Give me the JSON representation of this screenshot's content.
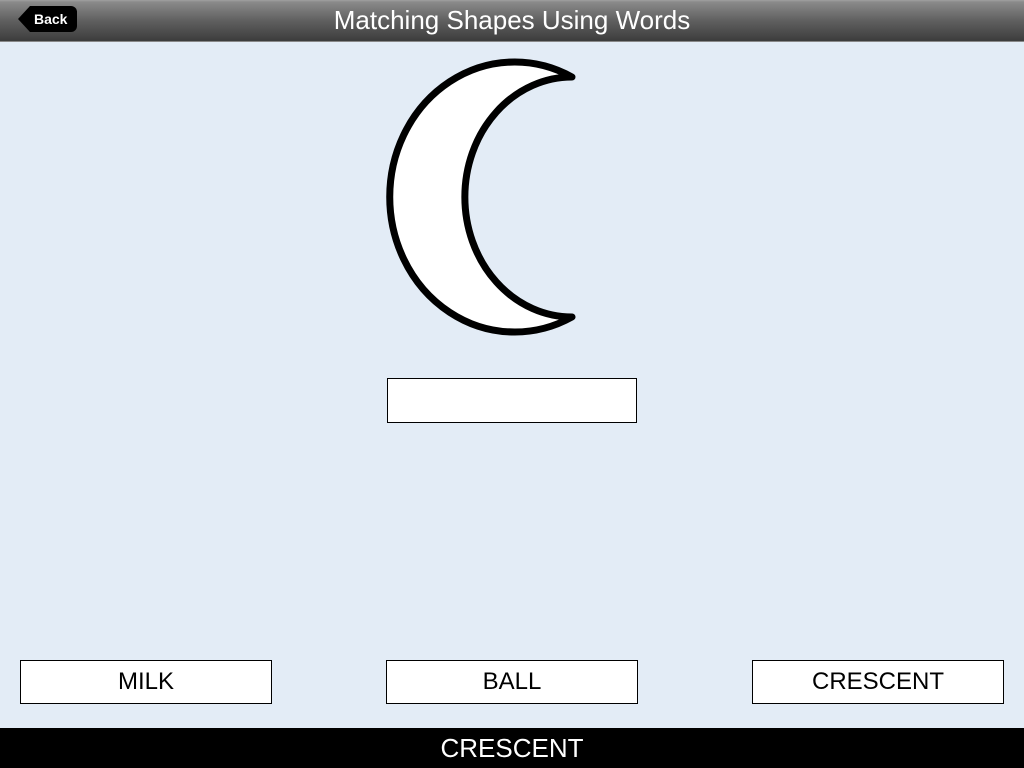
{
  "header": {
    "back_label": "Back",
    "title": "Matching Shapes Using Words"
  },
  "shape": {
    "name": "crescent"
  },
  "answer": {
    "value": ""
  },
  "options": [
    {
      "label": "MILK"
    },
    {
      "label": "BALL"
    },
    {
      "label": "CRESCENT"
    }
  ],
  "footer": {
    "text": "CRESCENT"
  }
}
